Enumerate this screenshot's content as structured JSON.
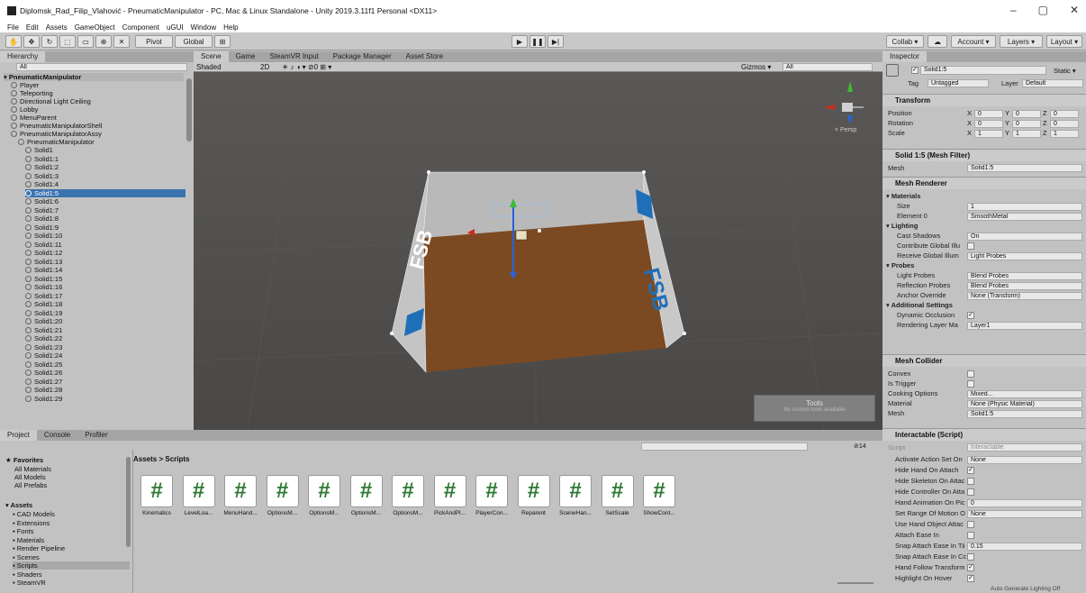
{
  "window": {
    "title": "Diplomsk_Rad_Filip_Vlahović - PneumaticManipulator - PC, Mac & Linux Standalone - Unity 2019.3.11f1 Personal <DX11>",
    "controls": [
      "–",
      "▢",
      "✕"
    ]
  },
  "menu": [
    "File",
    "Edit",
    "Assets",
    "GameObject",
    "Component",
    "uGUI",
    "Window",
    "Help"
  ],
  "toolbar": {
    "pivot": "Pivot",
    "global": "Global",
    "collab": "Collab ▾",
    "account": "Account ▾",
    "layers": "Layers ▾",
    "layout": "Layout ▾"
  },
  "hierarchy": {
    "tab": "Hierarchy",
    "search": "All",
    "scene": "PneumaticManipulator",
    "items": [
      "Player",
      "Teleporting",
      "Directional Light Ceiling",
      "Lobby",
      "MenuParent",
      "PneumaticManipulatorShell",
      "PneumaticManipulatorAssy",
      "PneumaticManipulator"
    ],
    "solids": [
      "Solid1",
      "Solid1:1",
      "Solid1:2",
      "Solid1:3",
      "Solid1:4",
      "Solid1:5",
      "Solid1:6",
      "Solid1:7",
      "Solid1:8",
      "Solid1:9",
      "Solid1:10",
      "Solid1:11",
      "Solid1:12",
      "Solid1:13",
      "Solid1:14",
      "Solid1:15",
      "Solid1:16",
      "Solid1:17",
      "Solid1:18",
      "Solid1:19",
      "Solid1:20",
      "Solid1:21",
      "Solid1:22",
      "Solid1:23",
      "Solid1:24",
      "Solid1:25",
      "Solid1:26",
      "Solid1:27",
      "Solid1:28",
      "Solid1:29"
    ],
    "selected": "Solid1:5"
  },
  "scene": {
    "tabs": [
      "Scene",
      "Game",
      "SteamVR Input",
      "Package Manager",
      "Asset Store"
    ],
    "shading": "Shaded",
    "dim": "2D",
    "gizmos": "Gizmos ▾",
    "search": "All",
    "persp": "< Persp",
    "tools_title": "Tools",
    "tools_sub": "No custom tools available",
    "logo": "FSB"
  },
  "project": {
    "tabs": [
      "Project",
      "Console",
      "Profiler"
    ],
    "breadcrumb": "Assets > Scripts",
    "count": "14",
    "favorites": "Favorites",
    "fav_items": [
      "All Materials",
      "All Models",
      "All Prefabs"
    ],
    "assets": "Assets",
    "asset_items": [
      "CAD Models",
      "Extensions",
      "Fonts",
      "Materials",
      "Render Pipeline",
      "Scenes",
      "Scripts",
      "Shaders",
      "SteamVR"
    ],
    "scripts": [
      "Kinematics",
      "LevelLoa...",
      "MenuHand...",
      "OptionsM...",
      "OptionsM...",
      "OptionsM...",
      "OptionsM...",
      "PickAndPl...",
      "PlayerCon...",
      "Reparent",
      "SceneHan...",
      "SetScale",
      "ShowCont..."
    ]
  },
  "inspector": {
    "tab": "Inspector",
    "name": "Solid1:5",
    "static": "Static ▾",
    "tag_label": "Tag",
    "tag": "Untagged",
    "layer_label": "Layer",
    "layer": "Default",
    "transform": {
      "title": "Transform",
      "rows": [
        {
          "label": "Position",
          "x": "0",
          "y": "0",
          "z": "0"
        },
        {
          "label": "Rotation",
          "x": "0",
          "y": "0",
          "z": "0"
        },
        {
          "label": "Scale",
          "x": "1",
          "y": "1",
          "z": "1"
        }
      ]
    },
    "meshfilter": {
      "title": "Solid 1:5 (Mesh Filter)",
      "mesh_label": "Mesh",
      "mesh": "Solid1:5"
    },
    "renderer": {
      "title": "Mesh Renderer",
      "materials": "Materials",
      "size_label": "Size",
      "size": "1",
      "el_label": "Element 0",
      "el": "SmoothMetal",
      "lighting": "Lighting",
      "cast_label": "Cast Shadows",
      "cast": "On",
      "contrib_label": "Contribute Global Illu",
      "receive_label": "Receive Global Illum",
      "receive": "Light Probes",
      "probes": "Probes",
      "lp_label": "Light Probes",
      "lp": "Blend Probes",
      "rp_label": "Reflection Probes",
      "rp": "Blend Probes",
      "ao_label": "Anchor Override",
      "ao": "None (Transform)",
      "add": "Additional Settings",
      "dyn_label": "Dynamic Occlusion",
      "rl_label": "Rendering Layer Ma",
      "rl": "Layer1"
    },
    "collider": {
      "title": "Mesh Collider",
      "convex": "Convex",
      "trigger": "Is Trigger",
      "cook_label": "Cooking Options",
      "cook": "Mixed...",
      "mat_label": "Material",
      "mat": "None (Physic Material)",
      "mesh_label": "Mesh",
      "mesh": "Solid1:5"
    },
    "interactable": {
      "title": "Interactable (Script)",
      "script_label": "Script",
      "script": "Interactable",
      "rows": [
        {
          "label": "Activate Action Set On",
          "value": "None"
        },
        {
          "label": "Hide Hand On Attach",
          "check": "✓"
        },
        {
          "label": "Hide Skeleton On Attac",
          "check": ""
        },
        {
          "label": "Hide Controller On Atta",
          "check": ""
        },
        {
          "label": "Hand Animation On Pic",
          "value": "0"
        },
        {
          "label": "Set Range Of Motion O",
          "value": "None"
        },
        {
          "label": "Use Hand Object Attac",
          "check": ""
        },
        {
          "label": "Attach Ease In",
          "check": ""
        },
        {
          "label": "Snap Attach Ease In Tii",
          "value": "0.15"
        },
        {
          "label": "Snap Attach Ease In Cc",
          "check": ""
        },
        {
          "label": "Hand Follow Transform",
          "check": "✓"
        },
        {
          "label": "Highlight On Hover",
          "check": "✓"
        }
      ]
    },
    "status": "Auto Generate Lighting Off"
  },
  "colors": {
    "selection": "#3a72b0",
    "floor": "#7a4a22",
    "wall": "#bfbfbf",
    "accent": "#1f6fb8"
  }
}
